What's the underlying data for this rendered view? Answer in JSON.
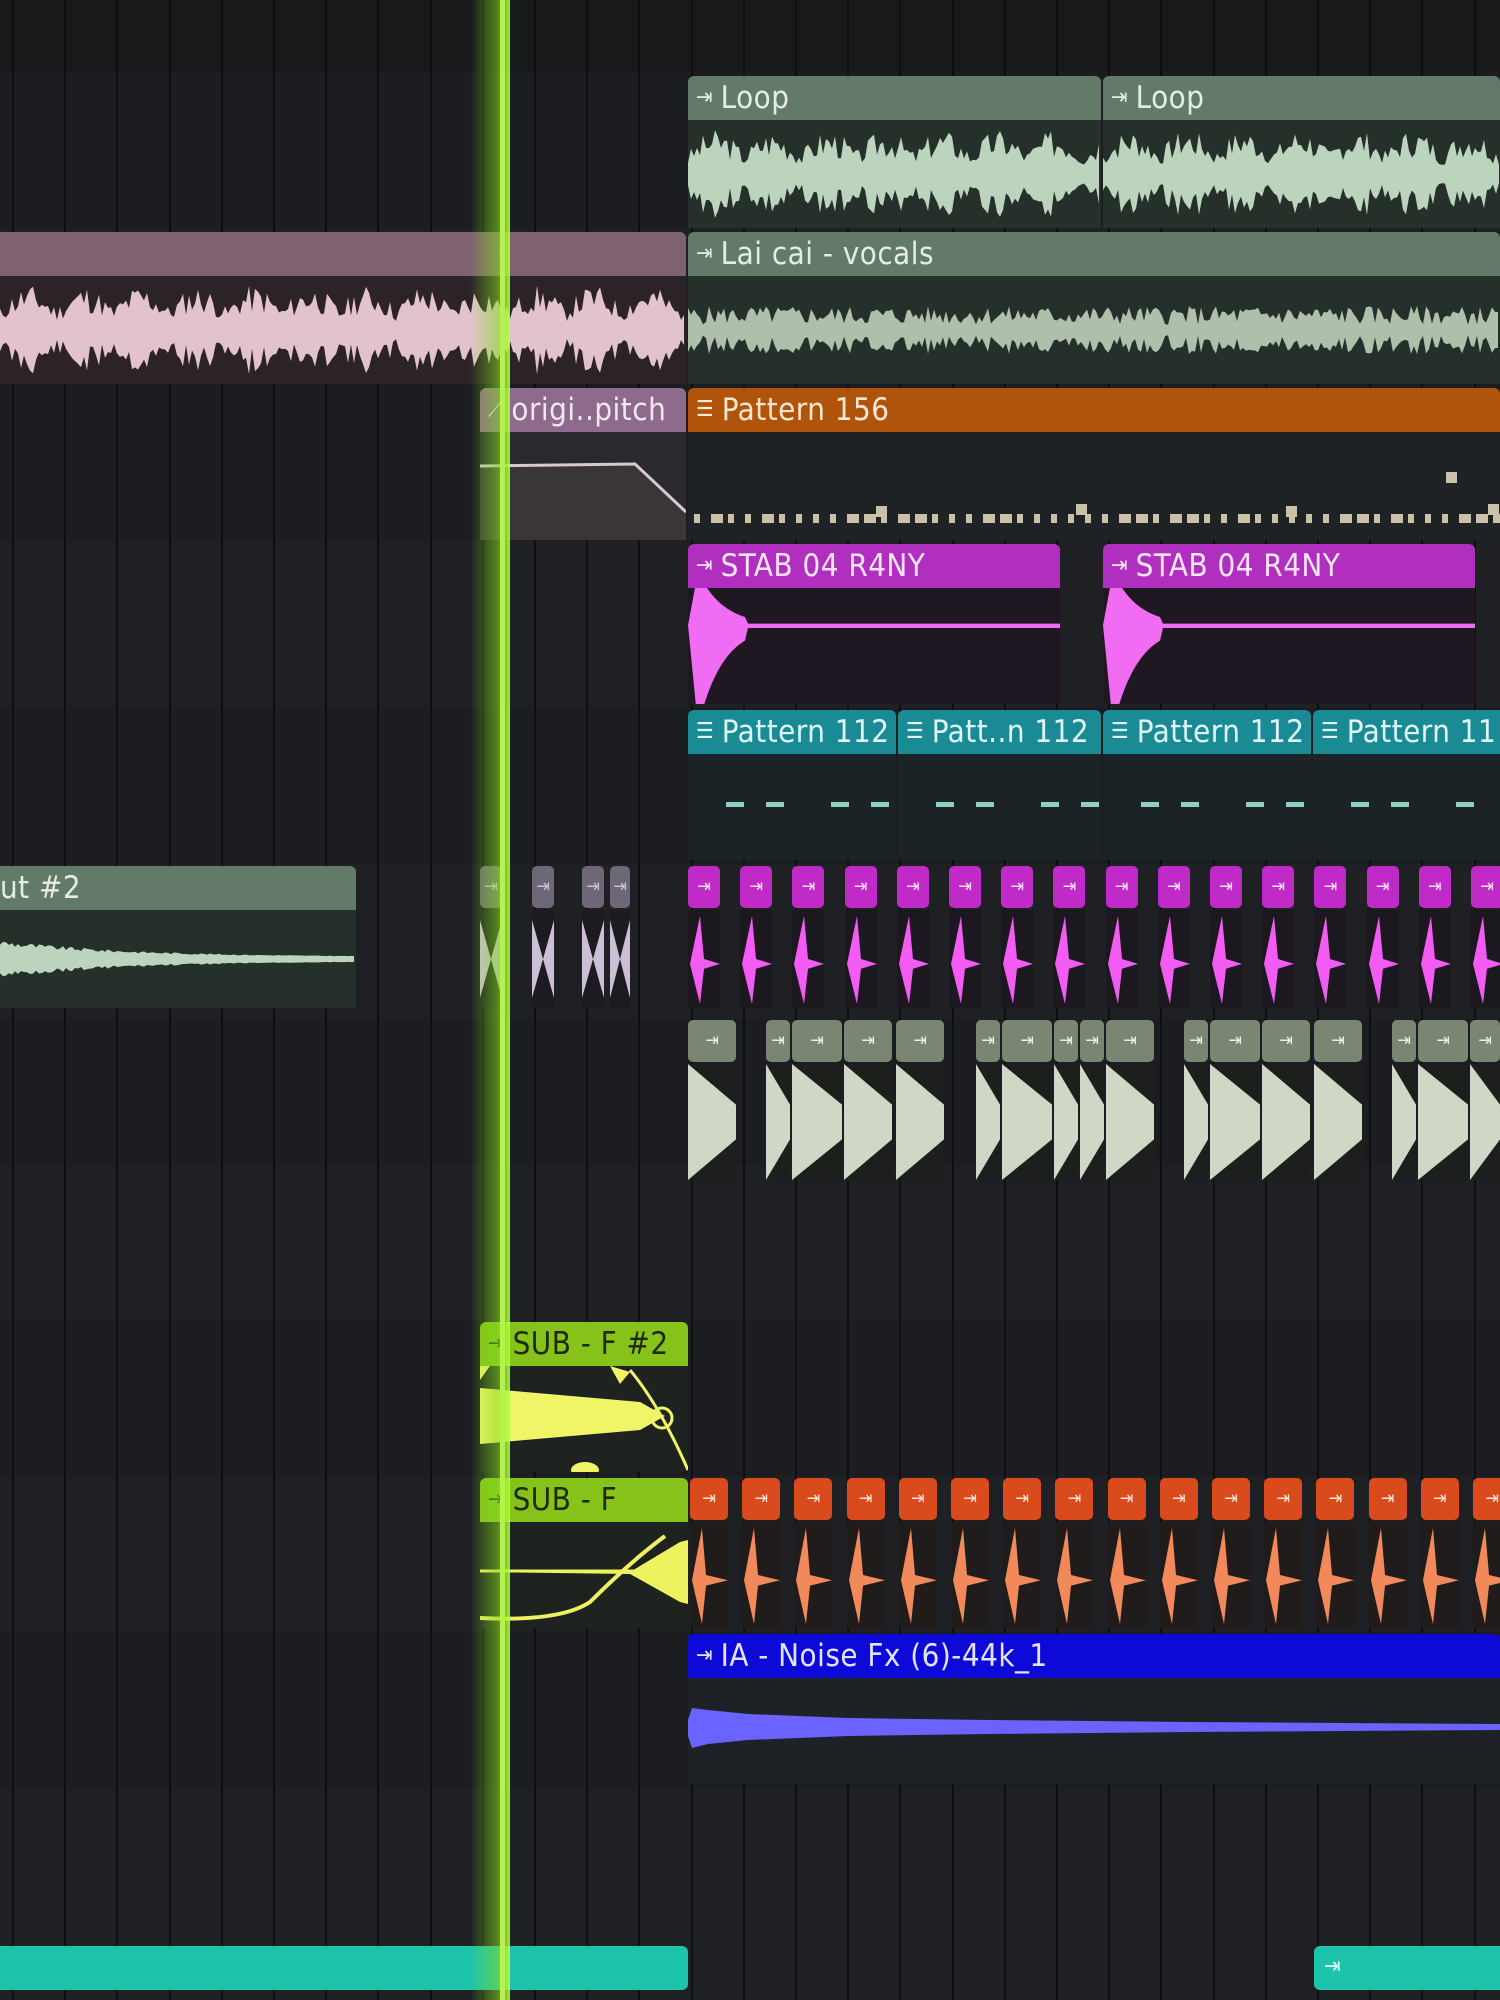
{
  "playlist": {
    "clips": {
      "loop_1": {
        "label": "Loop",
        "icon": "audio-clip-icon",
        "color": "#647a68"
      },
      "loop_2": {
        "label": "Loop",
        "icon": "audio-clip-icon",
        "color": "#647a68"
      },
      "vocals": {
        "label": "Lai cai - vocals",
        "icon": "audio-clip-icon",
        "color": "#647a68"
      },
      "automation": {
        "label": "origi..pitch",
        "icon": "automation-clip-icon",
        "color": "#8e6a8c"
      },
      "pattern_156": {
        "label": "Pattern 156",
        "icon": "pattern-clip-icon",
        "color": "#b0540c"
      },
      "stab_1": {
        "label": "STAB 04 R4NY",
        "icon": "audio-clip-icon",
        "color": "#b12fbf"
      },
      "stab_2": {
        "label": "STAB 04 R4NY",
        "icon": "audio-clip-icon",
        "color": "#b12fbf"
      },
      "pattern_112_a": {
        "label": "Pattern 112",
        "icon": "pattern-clip-icon",
        "color": "#1a8a95"
      },
      "pattern_112_b": {
        "label": "Patt..n 112",
        "icon": "pattern-clip-icon",
        "color": "#1a8a95"
      },
      "pattern_112_c": {
        "label": "Pattern 112",
        "icon": "pattern-clip-icon",
        "color": "#1a8a95"
      },
      "pattern_112_d": {
        "label": "Pattern 11",
        "icon": "pattern-clip-icon",
        "color": "#1a8a95"
      },
      "cut2": {
        "label": "ut #2",
        "icon": "audio-clip-icon",
        "color": "#647a68"
      },
      "sub_f2": {
        "label": "SUB - F #2",
        "icon": "audio-clip-icon",
        "color": "#86c21a"
      },
      "sub_f": {
        "label": "SUB - F",
        "icon": "audio-clip-icon",
        "color": "#86c21a"
      },
      "noise_fx": {
        "label": "IA - Noise Fx (6)-44k_1",
        "icon": "audio-clip-icon",
        "color": "#0d0ad8"
      }
    },
    "mini_clip_icon": "audio-clip-icon",
    "playhead_color": "#b7f24a"
  }
}
